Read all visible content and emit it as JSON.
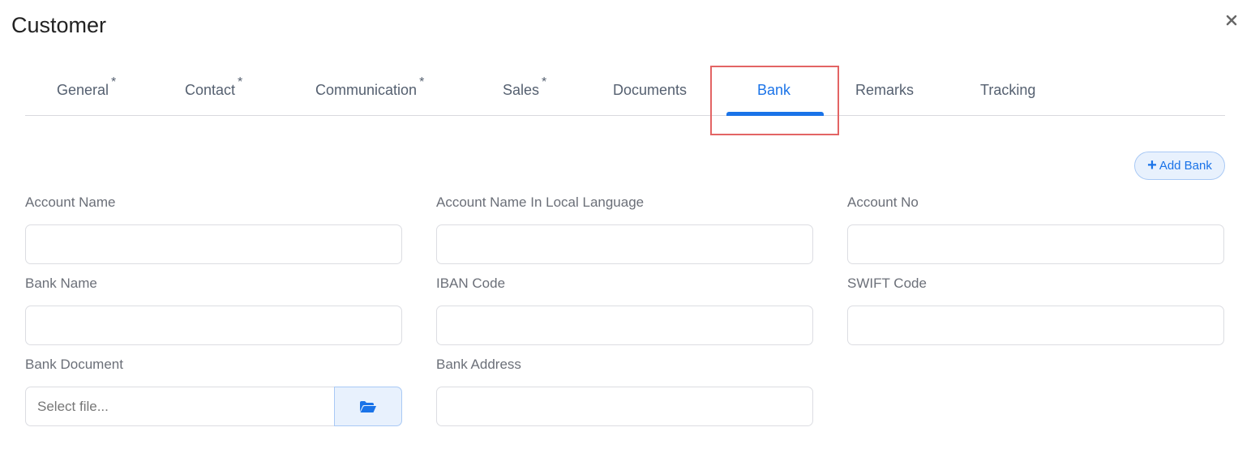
{
  "dialog": {
    "title": "Customer",
    "close_icon": "close-icon"
  },
  "tabs": [
    {
      "label": "General",
      "required": "*",
      "active": false
    },
    {
      "label": "Contact",
      "required": "*",
      "active": false
    },
    {
      "label": "Communication",
      "required": "*",
      "active": false
    },
    {
      "label": "Sales",
      "required": "*",
      "active": false
    },
    {
      "label": "Documents",
      "required": "",
      "active": false
    },
    {
      "label": "Bank",
      "required": "",
      "active": true
    },
    {
      "label": "Remarks",
      "required": "",
      "active": false
    },
    {
      "label": "Tracking",
      "required": "",
      "active": false
    }
  ],
  "colors": {
    "accent": "#1a73e8",
    "highlight_border": "#e36464",
    "tab_text": "#556070"
  },
  "actions": {
    "add_bank_label": "Add Bank",
    "add_bank_icon": "plus-icon"
  },
  "form": {
    "account_name": {
      "label": "Account Name",
      "value": "",
      "placeholder": ""
    },
    "account_name_local": {
      "label": "Account Name In Local Language",
      "value": "",
      "placeholder": ""
    },
    "account_no": {
      "label": "Account No",
      "value": "",
      "placeholder": ""
    },
    "bank_name": {
      "label": "Bank Name",
      "value": "",
      "placeholder": ""
    },
    "iban_code": {
      "label": "IBAN Code",
      "value": "",
      "placeholder": ""
    },
    "swift_code": {
      "label": "SWIFT Code",
      "value": "",
      "placeholder": ""
    },
    "bank_document": {
      "label": "Bank Document",
      "value": "",
      "placeholder": "Select file...",
      "browse_icon": "folder-open-icon"
    },
    "bank_address": {
      "label": "Bank Address",
      "value": "",
      "placeholder": ""
    }
  }
}
